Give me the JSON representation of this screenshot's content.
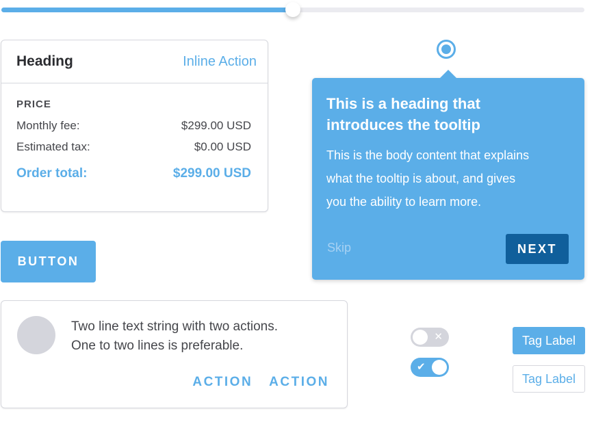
{
  "slider": {
    "value_percent": 50
  },
  "price_card": {
    "heading": "Heading",
    "inline_action": "Inline Action",
    "section_label": "PRICE",
    "rows": [
      {
        "label": "Monthly fee:",
        "value": "$299.00 USD"
      },
      {
        "label": "Estimated tax:",
        "value": "$0.00 USD"
      }
    ],
    "total": {
      "label": "Order total:",
      "value": "$299.00 USD"
    }
  },
  "button": {
    "label": "BUTTON"
  },
  "list_card": {
    "line1": "Two line text string with two actions.",
    "line2": "One to two lines is preferable.",
    "actions": [
      "ACTION",
      "ACTION"
    ]
  },
  "tooltip": {
    "heading_line1": "This is a heading that",
    "heading_line2": "introduces the tooltip",
    "body_line1": "This is the body content that explains",
    "body_line2": "what the tooltip is about, and gives",
    "body_line3": "you the ability to learn more.",
    "skip_label": "Skip",
    "next_label": "NEXT"
  },
  "toggles": [
    {
      "state": "off",
      "glyph": "✕"
    },
    {
      "state": "on",
      "glyph": "✔"
    }
  ],
  "tags": [
    {
      "label": "Tag Label",
      "style": "filled"
    },
    {
      "label": "Tag Label",
      "style": "outline"
    }
  ],
  "colors": {
    "accent": "#5baee8",
    "accent_dark": "#105f9b",
    "neutral": "#d4d5dc",
    "border": "#d6d7dd"
  }
}
